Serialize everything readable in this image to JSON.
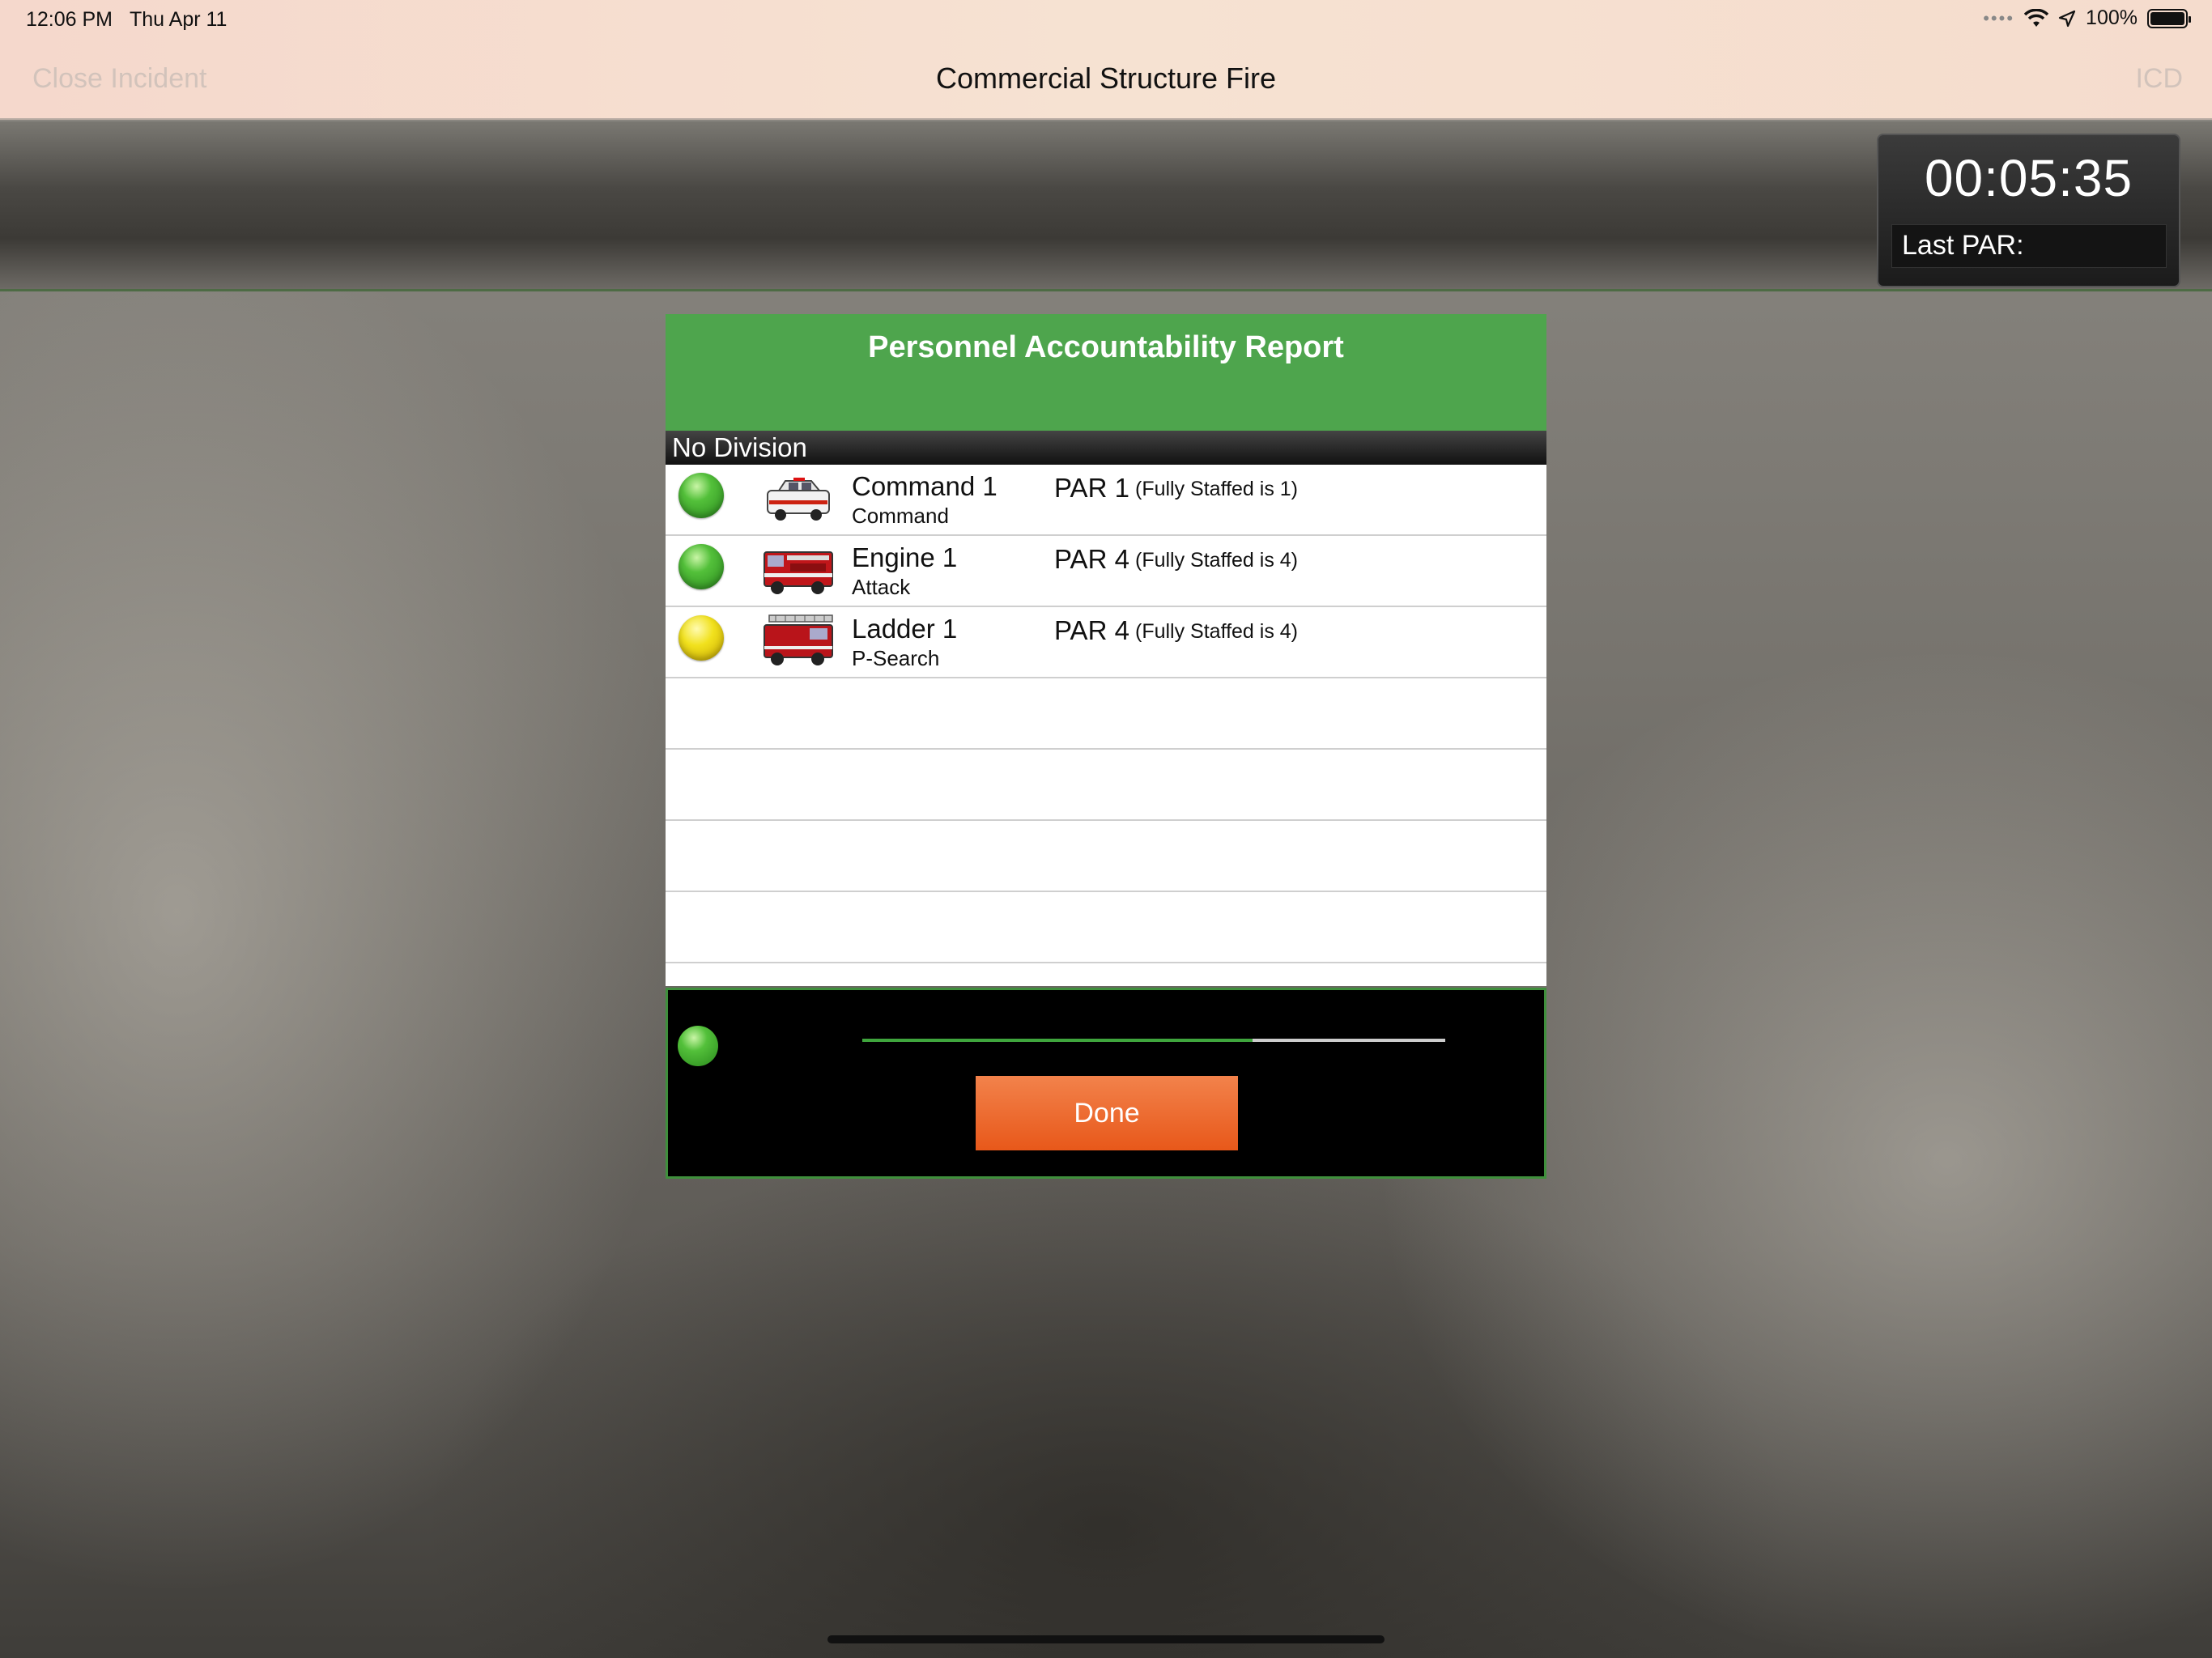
{
  "status_bar": {
    "time": "12:06 PM",
    "date": "Thu Apr 11",
    "battery": "100%"
  },
  "nav": {
    "left_button": "Close Incident",
    "title": "Commercial Structure Fire",
    "right_button": "ICD"
  },
  "timer": {
    "value": "00:05:35",
    "last_par_label": "Last PAR:"
  },
  "modal": {
    "title": "Personnel Accountability Report",
    "division": "No Division",
    "units": [
      {
        "name": "Command 1",
        "role": "Command",
        "par": "PAR 1",
        "staffed": "(Fully Staffed is 1)",
        "status": "green",
        "vehicle_icon": "command-suv-icon"
      },
      {
        "name": "Engine 1",
        "role": "Attack",
        "par": "PAR 4",
        "staffed": "(Fully Staffed is 4)",
        "status": "green",
        "vehicle_icon": "fire-engine-icon"
      },
      {
        "name": "Ladder 1",
        "role": "P-Search",
        "par": "PAR 4",
        "staffed": "(Fully Staffed is 4)",
        "status": "yellow",
        "vehicle_icon": "ladder-truck-icon"
      }
    ],
    "empty_rows": 4,
    "progress": 0.67,
    "done_label": "Done"
  },
  "colors": {
    "header_green": "#4ea54d",
    "done_orange": "#e8581a",
    "status_green": "#53c03a",
    "status_yellow": "#f1e11d"
  }
}
